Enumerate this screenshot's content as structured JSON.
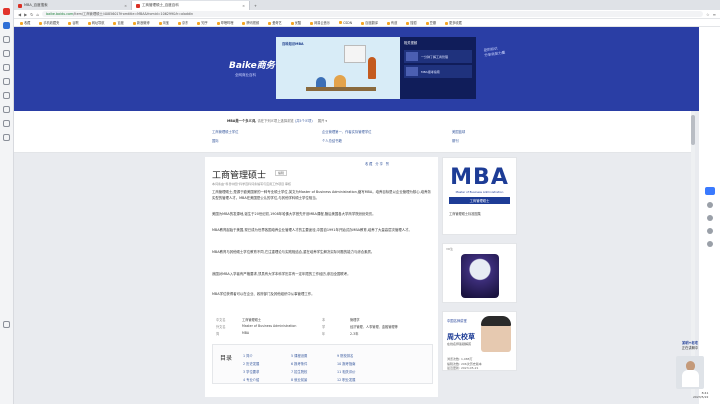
{
  "browser": {
    "tabs": [
      {
        "label": "MBA_百度搜索",
        "active": false
      },
      {
        "label": "工商管理硕士_百度百科",
        "active": true
      }
    ],
    "url_host": "baike.baidu.com",
    "url_path": "/item/工商管理硕士/4085601?fromtitle=MBA&fromid=106299&fr=aladdin",
    "bookmarks": [
      "收藏",
      "手机收藏夹",
      "谷歌",
      "网址导航",
      "百度",
      "新浪微博",
      "淘宝",
      "京东",
      "知乎",
      "哔哩哔哩",
      "腾讯视频",
      "爱奇艺",
      "优酷",
      "网易云音乐",
      "CSDN",
      "百度翻译",
      "有道",
      "搜狐",
      "豆瓣",
      "更多收藏"
    ]
  },
  "banner": {
    "logo": "Baike商务",
    "subtitle": "全网商业百科",
    "video_title": "百科知识MBA",
    "side_title": "相关视频",
    "side_items": [
      "一分钟了解工商管理",
      "MBA报考指南"
    ],
    "handwritten": "是的知识\n分享就是力量"
  },
  "breadcrumb": {
    "prefix": "MBA是一个多义词,",
    "current": "请在下列义项上选择浏览",
    "count": "(共5个义项)",
    "collapse": "展开 ▾"
  },
  "related": [
    "工商管理硕士学位",
    "企业管理第一、作者实际管理学位",
    "美国篮球",
    "国际",
    "个人总结书籍",
    "期刊"
  ],
  "article": {
    "title": "工商管理硕士",
    "edit": "编辑",
    "tools": "收藏 分享 赞",
    "tags": "本词条由“科普中国”科学百科词条编写与应用工作项目 审核",
    "paragraphs": [
      "工商管理硕士,是源于欧美国家的一种专业硕士学位,英文为Master of Business Administration,缩写MBA。培养目标是以企业管理为核心,培养务实型的管理人才。MBA在美国是公认的学位,与其他学科硕士学位相当。",
      "美国为MBA的发源地,诞生于20世纪初,1908年哈佛大学首先开设MBA课程,随后美国各大学商学院纷纷效仿。",
      "MBA教育起始于美国,现已成为世界各国培养企业管理人才的主要途径,中国自1991年开始试办MBA教育,培养了大量高层次管理人才。",
      "MBA教育与其他硕士学位教育不同,它注重理论与实践相结合,重在培养学生解决实际问题的能力与综合素质。",
      "我国对MBA入学者有严格要求,须具有大学本科学历并有一定年限的工作经历,参加全国联考。",
      "MBA学位获得者可以在企业、政府部门及其他组织中从事管理工作。"
    ],
    "info": [
      {
        "k": "中文名",
        "v": "工商管理硕士",
        "k2": "本",
        "v2": "管理学"
      },
      {
        "k": "外文名",
        "v": "Master of Business Administration",
        "k2": "学",
        "v2": "经济管理、人事管理、金融管理等"
      },
      {
        "k": "简",
        "v": "MBA",
        "k2": "年",
        "v2": "2-3年"
      }
    ],
    "toc_title": "目录",
    "toc": [
      "1 简介",
      "2 历史发展",
      "3 学位要求",
      "4 专业介绍",
      "5 课程设置",
      "6 报考条件",
      "7 招生院校",
      "8 就业前景",
      "9 院校排名",
      "10 报考指南",
      "11 相关评价",
      "12 职业发展"
    ]
  },
  "sidebar": {
    "mba_big": "MBA",
    "mba_sub": "Master of Business Administration",
    "mba_bar": "工商管理硕士",
    "mba_caption": "工商管理硕士标准图集",
    "ad1_label": "VR生",
    "ad2_top": "中国名师讲堂",
    "ad2_title": "周大校草",
    "ad2_sub": "在线名师答疑解惑",
    "stats": [
      "浏览次数: 1,088万",
      "编辑次数: 206次历史版本",
      "最近更新: 2023-05-21"
    ]
  },
  "overlay": {
    "name": "某明+老宅",
    "role": "正在讲解中"
  },
  "clock": {
    "time": "8:41",
    "date": "2023/5/22"
  }
}
